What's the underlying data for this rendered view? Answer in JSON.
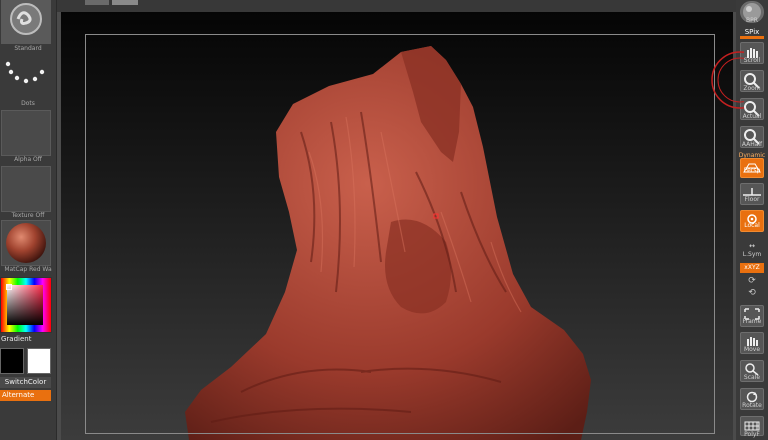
{
  "left_panel": {
    "brush_label": "Standard",
    "stroke_label": "Dots",
    "alpha_label": "Alpha Off",
    "texture_label": "Texture Off",
    "material_label": "MatCap Red Wa",
    "gradient_label": "Gradient",
    "switch_color_label": "SwitchColor",
    "alternate_label": "Alternate"
  },
  "right_panel": {
    "bpr_label": "BPR",
    "spix_label": "SPix",
    "scroll_label": "Scroll",
    "zoom_label": "Zoom",
    "actual_label": "Actual",
    "aahalf_label": "AAHalf",
    "dynamic_label": "Dynamic",
    "persp_label": "Persp",
    "floor_label": "Floor",
    "local_label": "Local",
    "lsym_label": "L.Sym",
    "xyz_label": "xXYZ",
    "frame_label": "Frame",
    "move_label": "Move",
    "scale_label": "Scale",
    "rotate_label": "Rotate",
    "polyf_label": "PolyF"
  },
  "colors": {
    "accent": "#e9700f",
    "model": "#b5493a",
    "picked_primary": "#000000",
    "picked_secondary": "#ffffff"
  }
}
